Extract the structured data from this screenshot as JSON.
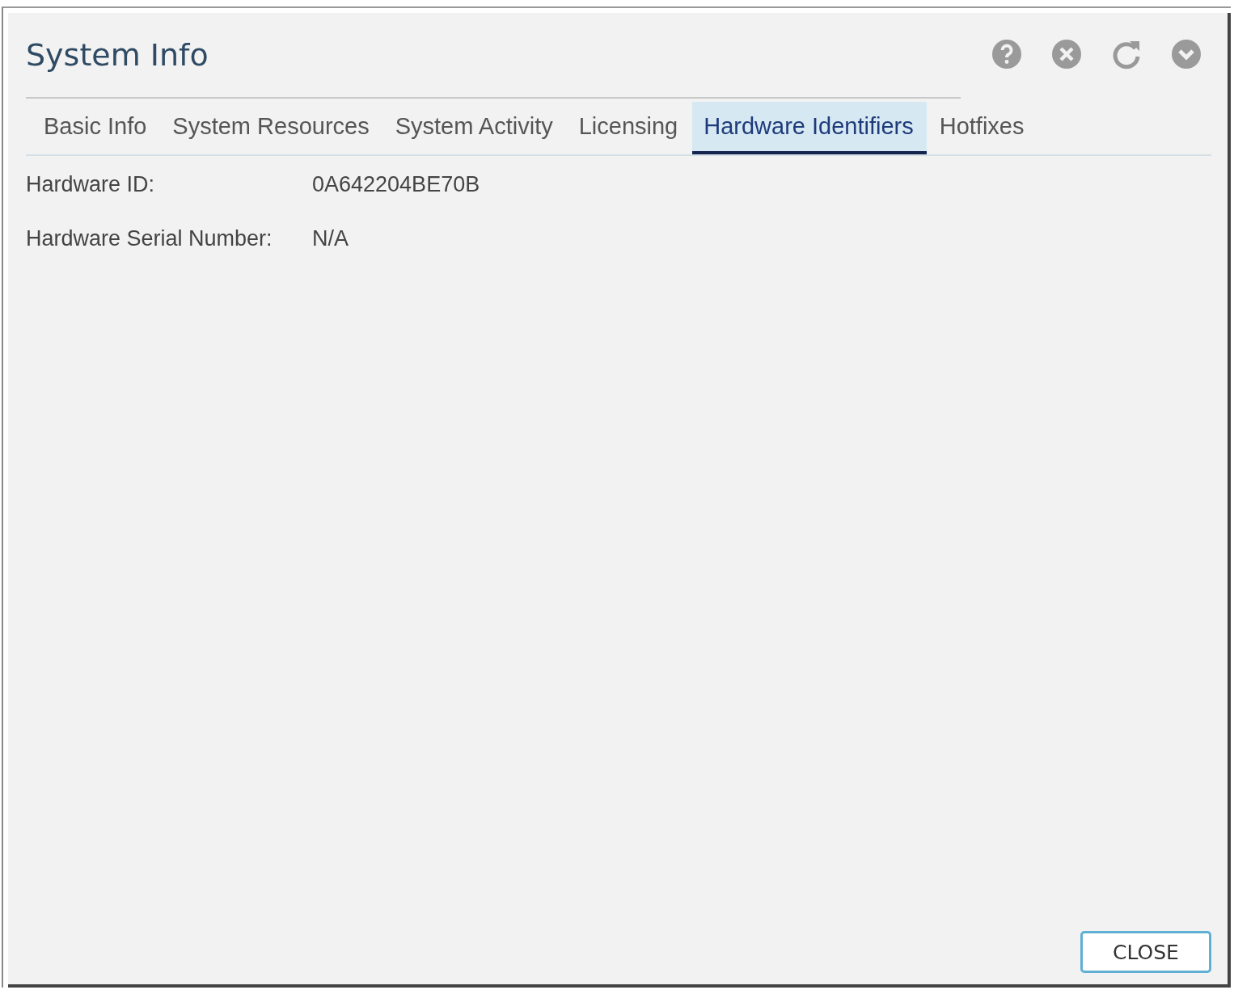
{
  "dialog": {
    "title": "System Info"
  },
  "header_icons": [
    {
      "kind": "help"
    },
    {
      "kind": "close"
    },
    {
      "kind": "refresh"
    },
    {
      "kind": "collapse"
    }
  ],
  "tabs": [
    {
      "label": "Basic Info",
      "selected": false
    },
    {
      "label": "System Resources",
      "selected": false
    },
    {
      "label": "System Activity",
      "selected": false
    },
    {
      "label": "Licensing",
      "selected": false
    },
    {
      "label": "Hardware Identifiers",
      "selected": true
    },
    {
      "label": "Hotfixes",
      "selected": false
    }
  ],
  "fields": [
    {
      "label": "Hardware ID:",
      "value": "0A642204BE70B"
    },
    {
      "label": "Hardware Serial Number:",
      "value": "N/A"
    }
  ],
  "buttons": [
    "CLOSE"
  ]
}
